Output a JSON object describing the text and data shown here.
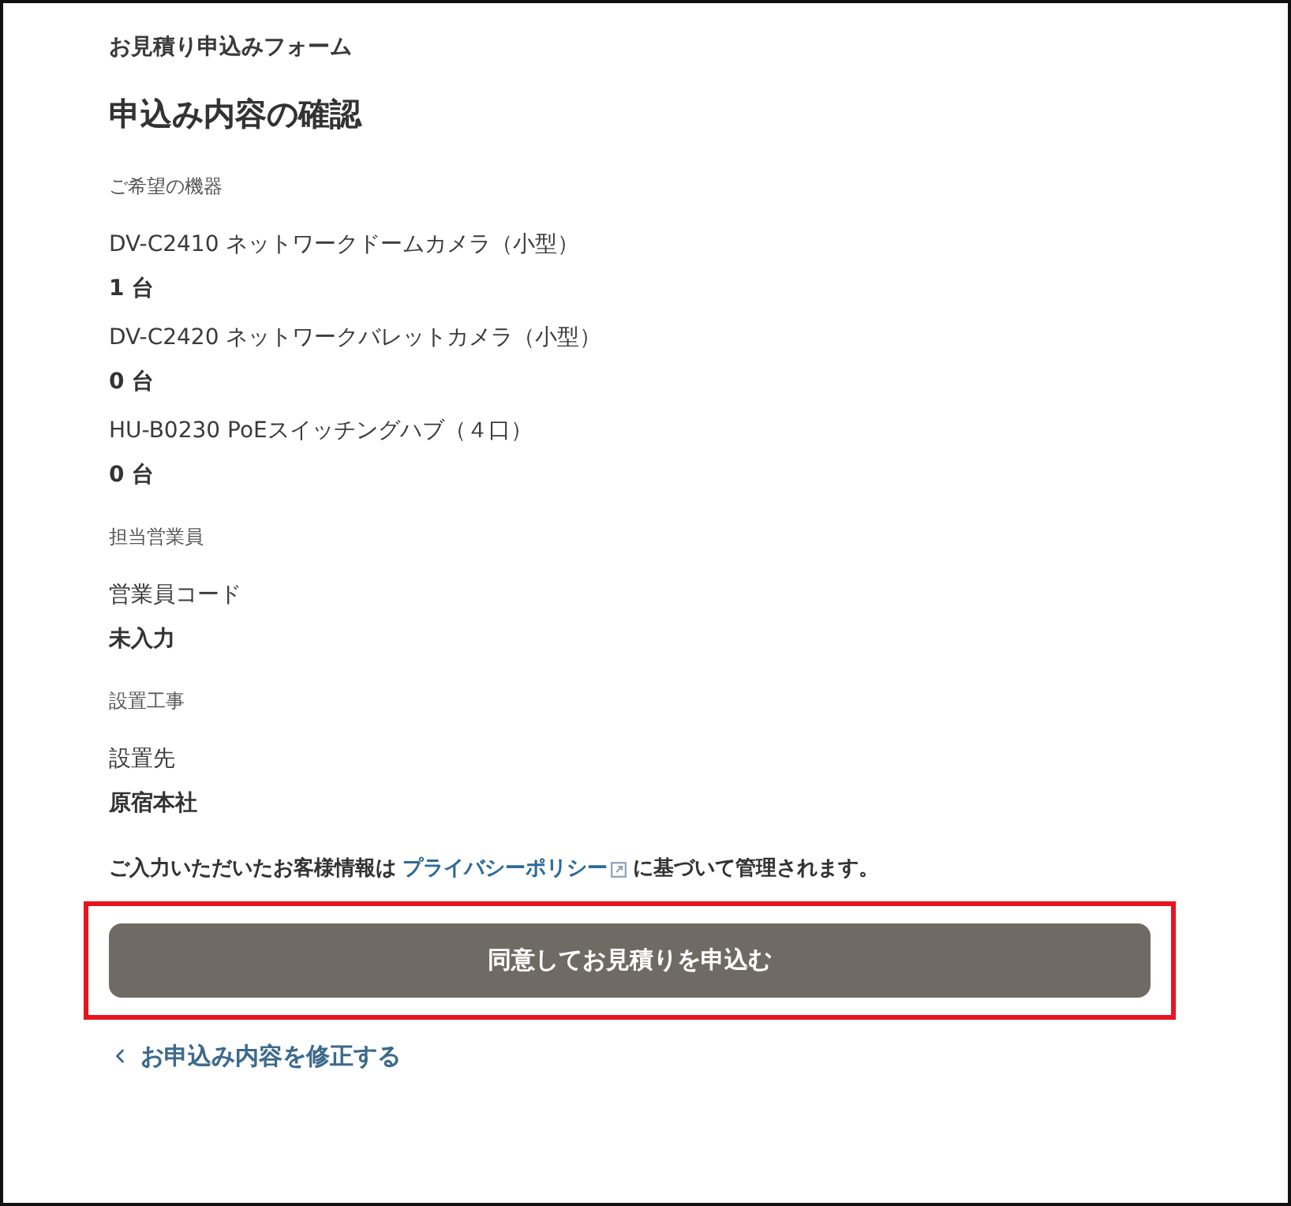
{
  "form_title": "お見積り申込みフォーム",
  "heading": "申込み内容の確認",
  "sections": [
    {
      "label": "ご希望の機器",
      "fields": [
        {
          "name": "DV-C2410 ネットワークドームカメラ（小型）",
          "value": "1 台"
        },
        {
          "name": "DV-C2420 ネットワークバレットカメラ（小型）",
          "value": "0 台"
        },
        {
          "name": "HU-B0230 PoEスイッチングハブ（４口）",
          "value": "0 台"
        }
      ]
    },
    {
      "label": "担当営業員",
      "fields": [
        {
          "name": "営業員コード",
          "value": "未入力"
        }
      ]
    },
    {
      "label": "設置工事",
      "fields": [
        {
          "name": "設置先",
          "value": "原宿本社"
        }
      ]
    }
  ],
  "privacy_notice": {
    "before": "ご入力いただいたお客様情報は",
    "link": "プライバシーポリシー",
    "after": "に基づいて管理されます。"
  },
  "submit_button": {
    "label": "同意してお見積りを申込む",
    "highlighted": true
  },
  "back_link": {
    "label": "お申込み内容を修正する"
  }
}
